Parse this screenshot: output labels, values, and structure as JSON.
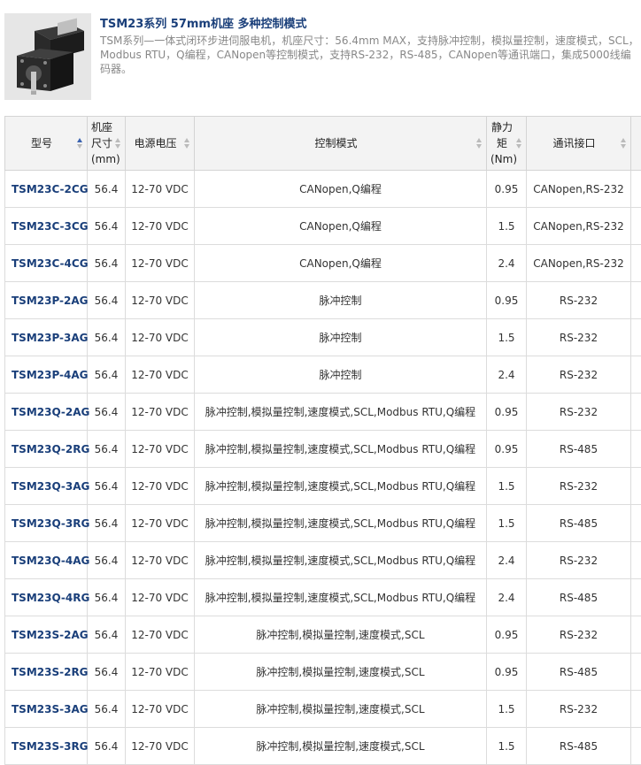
{
  "product": {
    "title": "TSM23系列 57mm机座 多种控制模式",
    "description": "TSM系列—一体式闭环步进伺服电机，机座尺寸：56.4mm MAX，支持脉冲控制，模拟量控制，速度模式，SCL，Modbus RTU，Q编程，CANopen等控制模式，支持RS-232，RS-485，CANopen等通讯端口，集成5000线编码器。",
    "image_icon": "motor-image"
  },
  "table": {
    "headers": [
      "型号",
      "机座尺寸(mm)",
      "电源电压",
      "控制模式",
      "静力矩(Nm)",
      "通讯接口"
    ],
    "rows": [
      [
        "TSM23C-2CG",
        "56.4",
        "12-70 VDC",
        "CANopen,Q编程",
        "0.95",
        "CANopen,RS-232"
      ],
      [
        "TSM23C-3CG",
        "56.4",
        "12-70 VDC",
        "CANopen,Q编程",
        "1.5",
        "CANopen,RS-232"
      ],
      [
        "TSM23C-4CG",
        "56.4",
        "12-70 VDC",
        "CANopen,Q编程",
        "2.4",
        "CANopen,RS-232"
      ],
      [
        "TSM23P-2AG",
        "56.4",
        "12-70 VDC",
        "脉冲控制",
        "0.95",
        "RS-232"
      ],
      [
        "TSM23P-3AG",
        "56.4",
        "12-70 VDC",
        "脉冲控制",
        "1.5",
        "RS-232"
      ],
      [
        "TSM23P-4AG",
        "56.4",
        "12-70 VDC",
        "脉冲控制",
        "2.4",
        "RS-232"
      ],
      [
        "TSM23Q-2AG",
        "56.4",
        "12-70 VDC",
        "脉冲控制,模拟量控制,速度模式,SCL,Modbus RTU,Q编程",
        "0.95",
        "RS-232"
      ],
      [
        "TSM23Q-2RG",
        "56.4",
        "12-70 VDC",
        "脉冲控制,模拟量控制,速度模式,SCL,Modbus RTU,Q编程",
        "0.95",
        "RS-485"
      ],
      [
        "TSM23Q-3AG",
        "56.4",
        "12-70 VDC",
        "脉冲控制,模拟量控制,速度模式,SCL,Modbus RTU,Q编程",
        "1.5",
        "RS-232"
      ],
      [
        "TSM23Q-3RG",
        "56.4",
        "12-70 VDC",
        "脉冲控制,模拟量控制,速度模式,SCL,Modbus RTU,Q编程",
        "1.5",
        "RS-485"
      ],
      [
        "TSM23Q-4AG",
        "56.4",
        "12-70 VDC",
        "脉冲控制,模拟量控制,速度模式,SCL,Modbus RTU,Q编程",
        "2.4",
        "RS-232"
      ],
      [
        "TSM23Q-4RG",
        "56.4",
        "12-70 VDC",
        "脉冲控制,模拟量控制,速度模式,SCL,Modbus RTU,Q编程",
        "2.4",
        "RS-485"
      ],
      [
        "TSM23S-2AG",
        "56.4",
        "12-70 VDC",
        "脉冲控制,模拟量控制,速度模式,SCL",
        "0.95",
        "RS-232"
      ],
      [
        "TSM23S-2RG",
        "56.4",
        "12-70 VDC",
        "脉冲控制,模拟量控制,速度模式,SCL",
        "0.95",
        "RS-485"
      ],
      [
        "TSM23S-3AG",
        "56.4",
        "12-70 VDC",
        "脉冲控制,模拟量控制,速度模式,SCL",
        "1.5",
        "RS-232"
      ],
      [
        "TSM23S-3RG",
        "56.4",
        "12-70 VDC",
        "脉冲控制,模拟量控制,速度模式,SCL",
        "1.5",
        "RS-485"
      ]
    ]
  },
  "colors": {
    "link": "#1a3f7a",
    "header_bg": "#f3f3f3",
    "border": "#d4d4d4",
    "sort_active": "#3a62b0"
  }
}
